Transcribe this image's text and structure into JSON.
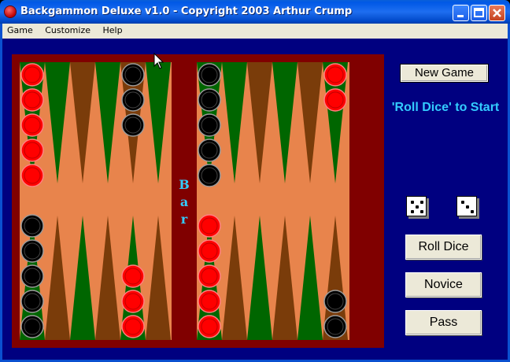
{
  "window": {
    "title": "Backgammon Deluxe v1.0 - Copyright 2003 Arthur Crump"
  },
  "menu": {
    "items": [
      "Game",
      "Customize",
      "Help"
    ]
  },
  "board": {
    "bar_label": [
      "B",
      "a",
      "r"
    ],
    "colors": {
      "background": "#000080",
      "frame": "#800000",
      "felt": "#e8844c",
      "point_green": "#006600",
      "point_brown": "#7a3c0a",
      "red_checker": "#ff0000",
      "black_checker": "#000000"
    },
    "top_points": [
      {
        "color": "green",
        "checkers": {
          "color": "red",
          "count": 5
        }
      },
      {
        "color": "green",
        "checkers": null
      },
      {
        "color": "brown",
        "checkers": null
      },
      {
        "color": "green",
        "checkers": null
      },
      {
        "color": "brown",
        "checkers": {
          "color": "black",
          "count": 3
        }
      },
      {
        "color": "green",
        "checkers": null
      },
      {
        "color": "green",
        "checkers": {
          "color": "black",
          "count": 5
        }
      },
      {
        "color": "green",
        "checkers": null
      },
      {
        "color": "brown",
        "checkers": null
      },
      {
        "color": "green",
        "checkers": null
      },
      {
        "color": "brown",
        "checkers": null
      },
      {
        "color": "green",
        "checkers": {
          "color": "red",
          "count": 2
        }
      }
    ],
    "bottom_points": [
      {
        "color": "green",
        "checkers": {
          "color": "black",
          "count": 5
        }
      },
      {
        "color": "brown",
        "checkers": null
      },
      {
        "color": "green",
        "checkers": null
      },
      {
        "color": "brown",
        "checkers": null
      },
      {
        "color": "green",
        "checkers": {
          "color": "red",
          "count": 3
        }
      },
      {
        "color": "brown",
        "checkers": null
      },
      {
        "color": "green",
        "checkers": {
          "color": "red",
          "count": 5
        }
      },
      {
        "color": "brown",
        "checkers": null
      },
      {
        "color": "green",
        "checkers": null
      },
      {
        "color": "brown",
        "checkers": null
      },
      {
        "color": "green",
        "checkers": null
      },
      {
        "color": "brown",
        "checkers": {
          "color": "black",
          "count": 2
        }
      }
    ]
  },
  "controls": {
    "new_game": "New Game",
    "status": "'Roll Dice' to Start",
    "roll_dice": "Roll Dice",
    "novice": "Novice",
    "pass": "Pass"
  },
  "dice": [
    5,
    3
  ]
}
